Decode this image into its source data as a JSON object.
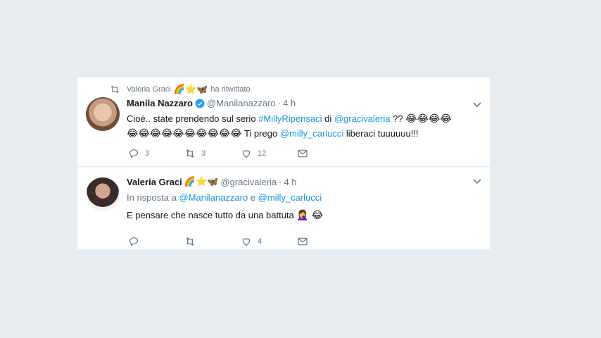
{
  "retweet": {
    "user": "Valeria Graci",
    "emojis": "🌈⭐🦋",
    "label": "ha ritwittato"
  },
  "tweet1": {
    "name": "Manila Nazzaro",
    "handle": "@Manilanazzaro",
    "dot": "·",
    "time": "4 h",
    "text_part1": "Cioè.. state prendendo sul serio ",
    "hashtag": "#MillyRipensaci",
    "text_part2": " di ",
    "mention1": "@gracivaleria",
    "text_part3": " ?? ",
    "emoji_run1": "😂😂😂😂",
    "emoji_run2": "😂😂😂😂😂😂😂😂😂😂",
    "text_part4": " Ti prego ",
    "mention2": "@milly_carlucci",
    "text_part5": " liberaci tuuuuuu!!!",
    "replies": "3",
    "retweets": "3",
    "likes": "12"
  },
  "tweet2": {
    "name": "Valeria Graci",
    "emojis": "🌈⭐🦋",
    "handle": "@gracivaleria",
    "dot": "·",
    "time": "4 h",
    "reply_prefix": "In risposta a ",
    "reply_mention1": "@Manilanazzaro",
    "reply_and": " e ",
    "reply_mention2": "@milly_carlucci",
    "text": "E pensare che nasce tutto da una battuta ",
    "text_emoji": "🤦‍♀️ 😂",
    "replies": "",
    "retweets": "",
    "likes": "4"
  }
}
